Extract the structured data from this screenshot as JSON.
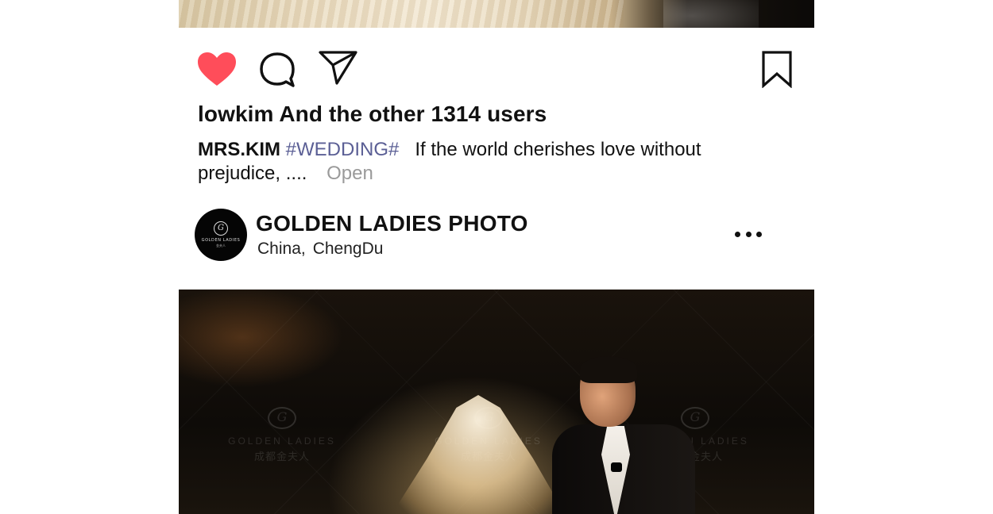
{
  "post": {
    "likes_text": "lowkim And the other 1314 users",
    "caption": {
      "author": "MRS.KIM",
      "hashtag": "#WEDDING#",
      "text": "If the world cherishes love without prejudice, ....",
      "more_label": "Open"
    },
    "liked": true,
    "accent_color": "#ff4d5a"
  },
  "account": {
    "name": "GOLDEN LADIES PHOTO",
    "location_country": "China,",
    "location_city": "ChengDu",
    "avatar_logo_text": "GOLDEN LADIES",
    "avatar_logo_sub": "金夫人"
  },
  "watermark": {
    "text": "GOLDEN LADIES",
    "sub": "成都金夫人"
  },
  "icons": {
    "like": "heart-icon",
    "comment": "comment-icon",
    "share": "send-icon",
    "save": "bookmark-icon",
    "more": "more-options-icon"
  }
}
